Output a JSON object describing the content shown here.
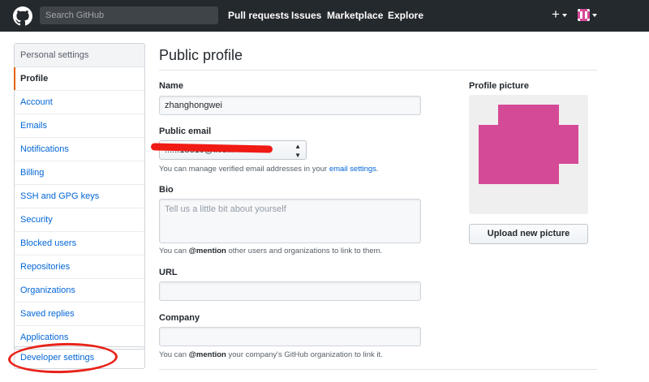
{
  "header": {
    "search_placeholder": "Search GitHub",
    "nav": [
      "Pull requests",
      "Issues",
      "Marketplace",
      "Explore"
    ],
    "new_icon": "plus-icon",
    "avatar_icon": "identicon-avatar"
  },
  "menu": {
    "heading": "Personal settings",
    "items": [
      "Profile",
      "Account",
      "Emails",
      "Notifications",
      "Billing",
      "SSH and GPG keys",
      "Security",
      "Blocked users",
      "Repositories",
      "Organizations",
      "Saved replies",
      "Applications"
    ],
    "selected": "Profile",
    "developer": "Developer settings"
  },
  "main": {
    "title": "Public profile",
    "name_label": "Name",
    "name_value": "zhanghongwei",
    "email_label": "Public email",
    "email_value": "......18810@live...",
    "email_note_prefix": "You can manage verified email addresses in your ",
    "email_note_link": "email settings",
    "email_note_suffix": ".",
    "bio_label": "Bio",
    "bio_placeholder": "Tell us a little bit about yourself",
    "bio_note_prefix": "You can ",
    "bio_note_mention": "@mention",
    "bio_note_suffix": " other users and organizations to link to them.",
    "url_label": "URL",
    "company_label": "Company",
    "company_note_prefix": "You can ",
    "company_note_mention": "@mention",
    "company_note_suffix": " your company's GitHub organization to link it."
  },
  "profile_picture": {
    "label": "Profile picture",
    "upload_button": "Upload new picture"
  },
  "colors": {
    "header_bg": "#24292e",
    "link": "#0366d6",
    "selected_marker": "#e36209",
    "identicon": "#d54a96",
    "annotation_red": "#e8231a"
  }
}
